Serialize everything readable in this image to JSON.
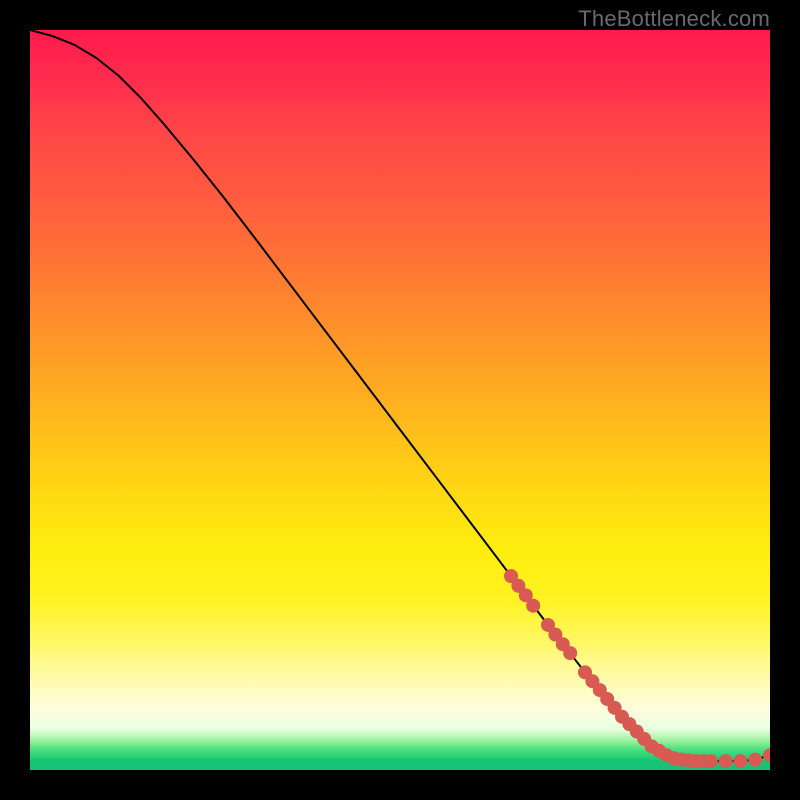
{
  "watermark": "TheBottleneck.com",
  "chart_data": {
    "type": "line",
    "title": "",
    "xlabel": "",
    "ylabel": "",
    "xlim": [
      0,
      100
    ],
    "ylim": [
      0,
      100
    ],
    "grid": false,
    "legend": false,
    "series": [
      {
        "name": "bottleneck-curve",
        "x": [
          0,
          3,
          6,
          9,
          12,
          15,
          18,
          22,
          26,
          30,
          35,
          40,
          45,
          50,
          55,
          60,
          65,
          70,
          75,
          80,
          84,
          86,
          88,
          90,
          92,
          94,
          96,
          98,
          100
        ],
        "y": [
          100,
          99.2,
          98.0,
          96.2,
          93.8,
          90.8,
          87.4,
          82.6,
          77.6,
          72.4,
          65.8,
          59.2,
          52.6,
          46.0,
          39.4,
          32.8,
          26.2,
          19.6,
          13.2,
          7.2,
          3.2,
          2.0,
          1.4,
          1.2,
          1.2,
          1.2,
          1.2,
          1.4,
          2.0
        ]
      }
    ],
    "markers": [
      {
        "name": "highlight-points",
        "color": "#d85a52",
        "points": [
          {
            "x": 65,
            "y": 26.2
          },
          {
            "x": 66,
            "y": 24.9
          },
          {
            "x": 67,
            "y": 23.6
          },
          {
            "x": 68,
            "y": 22.2
          },
          {
            "x": 70,
            "y": 19.6
          },
          {
            "x": 71,
            "y": 18.3
          },
          {
            "x": 72,
            "y": 17.0
          },
          {
            "x": 73,
            "y": 15.8
          },
          {
            "x": 75,
            "y": 13.2
          },
          {
            "x": 76,
            "y": 12.0
          },
          {
            "x": 77,
            "y": 10.8
          },
          {
            "x": 78,
            "y": 9.6
          },
          {
            "x": 79,
            "y": 8.4
          },
          {
            "x": 80,
            "y": 7.2
          },
          {
            "x": 81,
            "y": 6.2
          },
          {
            "x": 82,
            "y": 5.2
          },
          {
            "x": 83,
            "y": 4.2
          },
          {
            "x": 84,
            "y": 3.2
          },
          {
            "x": 85,
            "y": 2.6
          },
          {
            "x": 86,
            "y": 2.0
          },
          {
            "x": 87,
            "y": 1.6
          },
          {
            "x": 88,
            "y": 1.4
          },
          {
            "x": 89,
            "y": 1.3
          },
          {
            "x": 90,
            "y": 1.2
          },
          {
            "x": 91,
            "y": 1.2
          },
          {
            "x": 92,
            "y": 1.2
          },
          {
            "x": 94,
            "y": 1.2
          },
          {
            "x": 96,
            "y": 1.2
          },
          {
            "x": 98,
            "y": 1.4
          },
          {
            "x": 100,
            "y": 2.0
          }
        ]
      }
    ]
  }
}
